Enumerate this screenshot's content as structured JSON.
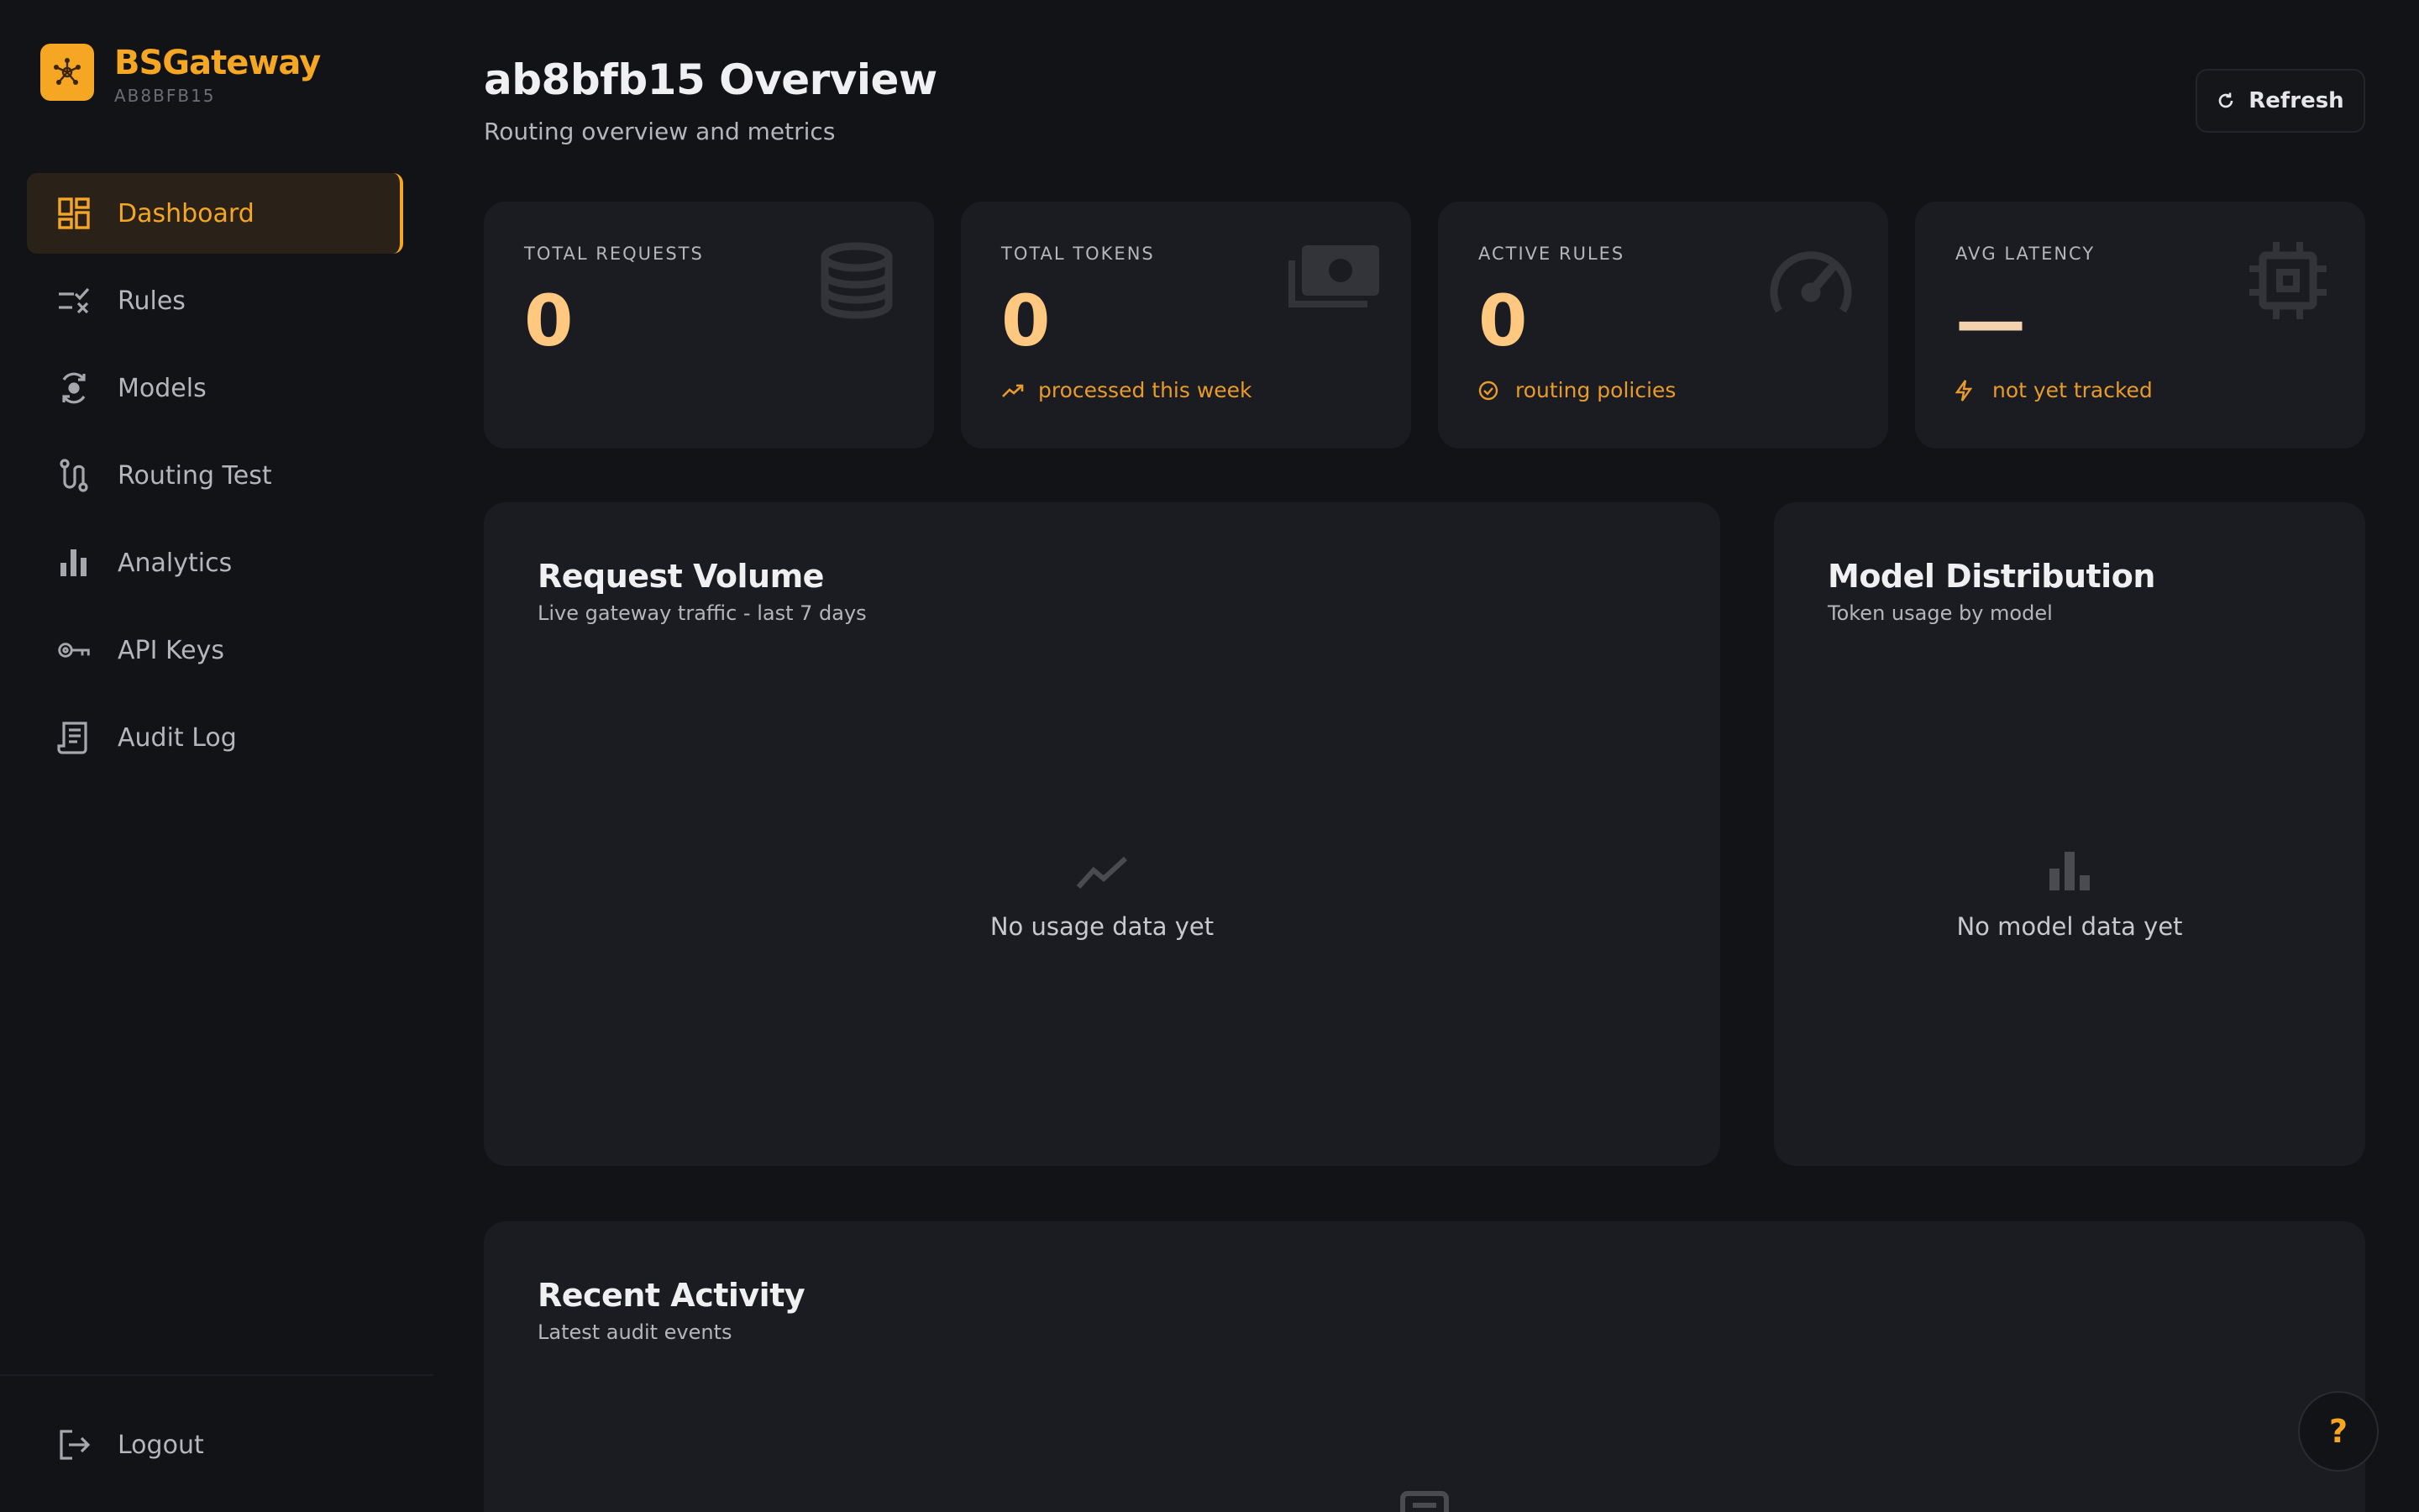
{
  "brand": {
    "name": "BSGateway",
    "sub": "AB8BFB15"
  },
  "nav": {
    "items": [
      {
        "label": "Dashboard",
        "icon": "dashboard-icon",
        "active": true
      },
      {
        "label": "Rules",
        "icon": "rules-icon"
      },
      {
        "label": "Models",
        "icon": "models-icon"
      },
      {
        "label": "Routing Test",
        "icon": "route-icon"
      },
      {
        "label": "Analytics",
        "icon": "bar-chart-icon"
      },
      {
        "label": "API Keys",
        "icon": "key-icon"
      },
      {
        "label": "Audit Log",
        "icon": "receipt-icon"
      }
    ],
    "logout": "Logout"
  },
  "header": {
    "title": "ab8bfb15 Overview",
    "subtitle": "Routing overview and metrics",
    "refresh_label": "Refresh"
  },
  "stats": [
    {
      "label": "TOTAL REQUESTS",
      "value": "0",
      "icon": "database-icon"
    },
    {
      "label": "TOTAL TOKENS",
      "value": "0",
      "footer": "processed this week",
      "icon": "cash-icon",
      "footer_icon": "trending-up-icon"
    },
    {
      "label": "ACTIVE RULES",
      "value": "0",
      "footer": "routing policies",
      "icon": "speedometer-icon",
      "footer_icon": "check-circle-icon"
    },
    {
      "label": "AVG LATENCY",
      "value": "—",
      "footer": "not yet tracked",
      "icon": "chip-icon",
      "footer_icon": "bolt-icon"
    }
  ],
  "request_volume": {
    "title": "Request Volume",
    "subtitle": "Live gateway traffic - last 7 days",
    "empty": "No usage data yet"
  },
  "model_distribution": {
    "title": "Model Distribution",
    "subtitle": "Token usage by model",
    "empty": "No model data yet"
  },
  "recent_activity": {
    "title": "Recent Activity",
    "subtitle": "Latest audit events"
  },
  "help": {
    "label": "?"
  },
  "colors": {
    "accent": "#f5a623",
    "value": "#ffc880",
    "background": "#121317",
    "card": "#1b1c21"
  }
}
